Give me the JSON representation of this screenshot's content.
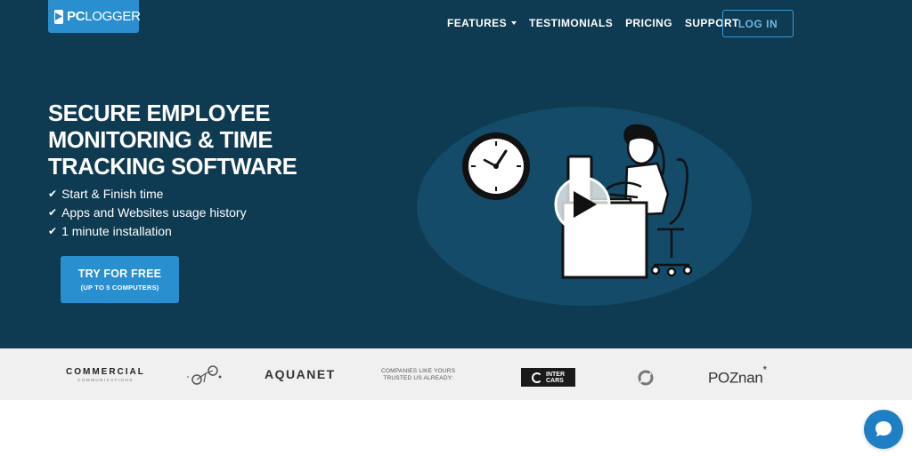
{
  "header": {
    "logo_bold": "PC",
    "logo_rest": "LOGGER",
    "nav": [
      {
        "label": "FEATURES",
        "has_dropdown": true
      },
      {
        "label": "TESTIMONIALS"
      },
      {
        "label": "PRICING"
      },
      {
        "label": "SUPPORT"
      }
    ],
    "login_label": "LOG IN"
  },
  "hero": {
    "headline": [
      "SECURE EMPLOYEE",
      "MONITORING & TIME",
      "TRACKING SOFTWARE"
    ],
    "features": [
      "Start & Finish time",
      "Apps and Websites usage history",
      "1 minute installation"
    ],
    "check_glyph": "✔",
    "cta_main": "TRY FOR FREE",
    "cta_sub": "(UP TO 5 COMPUTERS)",
    "video_play_icon": "play-icon"
  },
  "clients": {
    "commercial_big": "COMMERCIAL",
    "commercial_small": "COMMUNICATIONS",
    "aquanet": "AQUANET",
    "tagline": [
      "COMPANIES LIKE YOURS",
      "TRUSTED US ALREADY:"
    ],
    "intercars": [
      "INTER",
      "CARS"
    ],
    "poznan": "POZnan",
    "poznan_star": "*"
  },
  "colors": {
    "hero_bg": "#0e3a52",
    "accent": "#2a8fcf",
    "logos_bg": "#f0f0f0",
    "chat": "#1e7fc4"
  }
}
